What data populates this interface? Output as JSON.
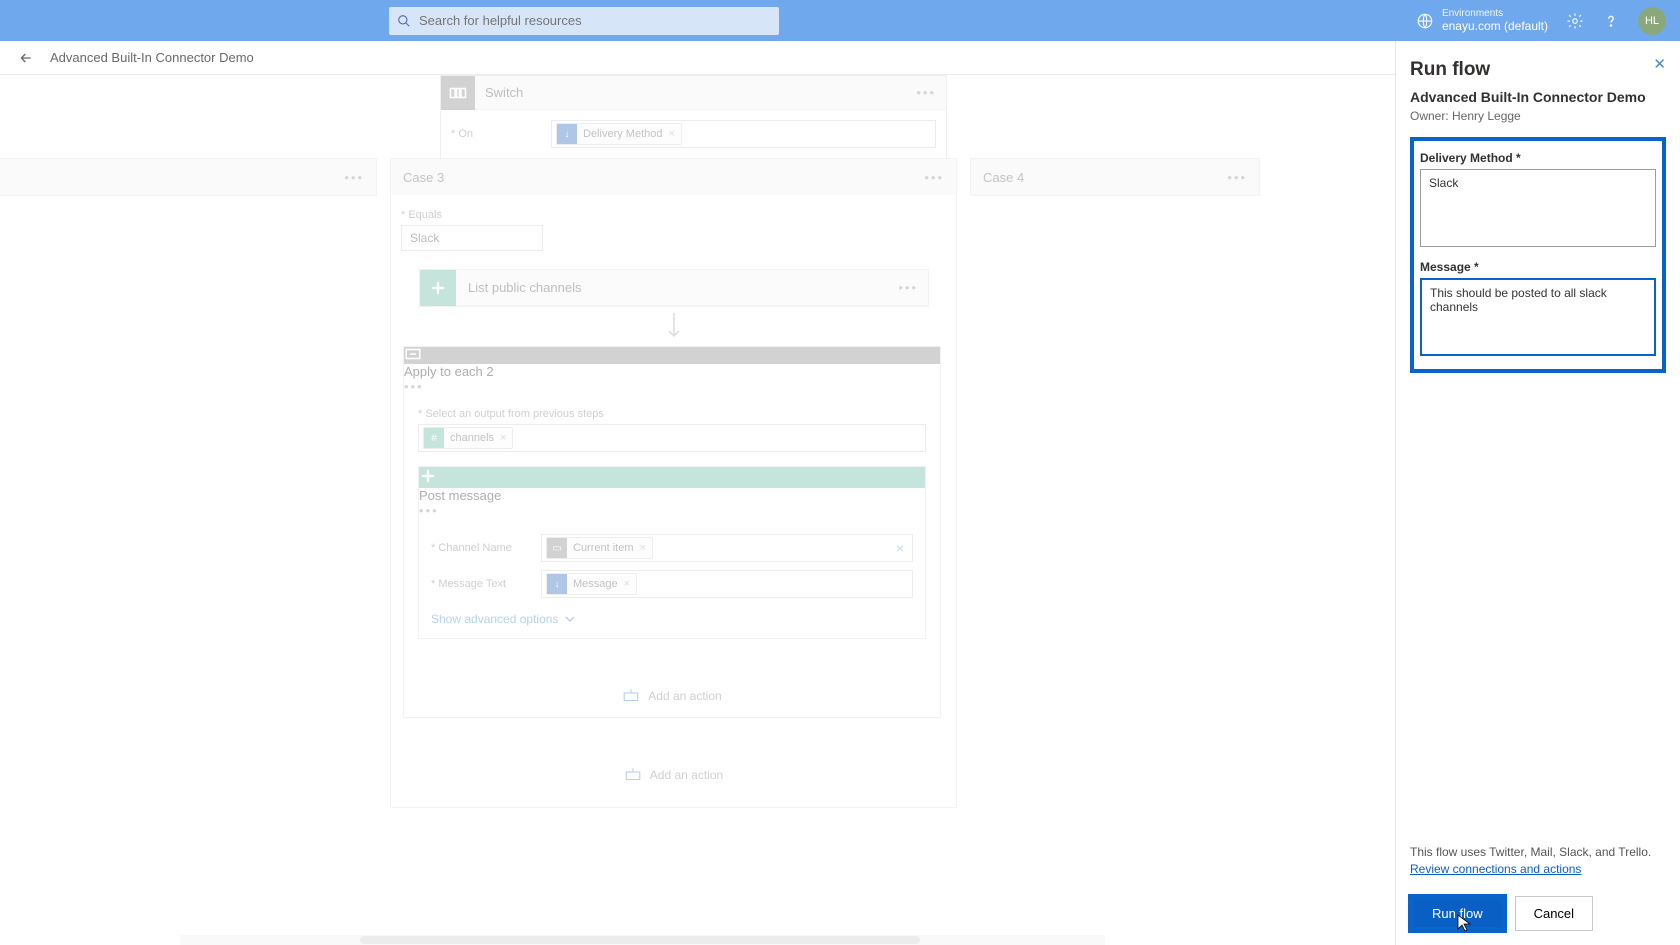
{
  "topbar": {
    "search_placeholder": "Search for helpful resources",
    "env_label": "Environments",
    "env_value": "enayu.com (default)",
    "avatar": "HL"
  },
  "breadcrumb": {
    "title": "Advanced Built-In Connector Demo"
  },
  "switch": {
    "title": "Switch",
    "on_label": "On",
    "on_token": "Delivery Method"
  },
  "case3": {
    "title": "Case 3",
    "equals_label": "Equals",
    "equals_value": "Slack",
    "list_channels": "List public channels",
    "apply_each": "Apply to each 2",
    "select_output_label": "Select an output from previous steps",
    "channels_token": "channels",
    "post_message": "Post message",
    "channel_name_label": "Channel Name",
    "current_item_token": "Current item",
    "message_text_label": "Message Text",
    "message_token": "Message",
    "show_advanced": "Show advanced options",
    "add_action": "Add an action"
  },
  "case4": {
    "title": "Case 4"
  },
  "panel": {
    "title": "Run flow",
    "subtitle": "Advanced Built-In Connector Demo",
    "owner": "Owner: Henry Legge",
    "delivery_label": "Delivery Method *",
    "delivery_value": "Slack",
    "message_label": "Message *",
    "message_value": "This should be posted to all slack channels",
    "foot_note": "This flow uses Twitter, Mail, Slack, and Trello.",
    "foot_link": "Review connections and actions",
    "run_btn": "Run flow",
    "cancel_btn": "Cancel"
  }
}
